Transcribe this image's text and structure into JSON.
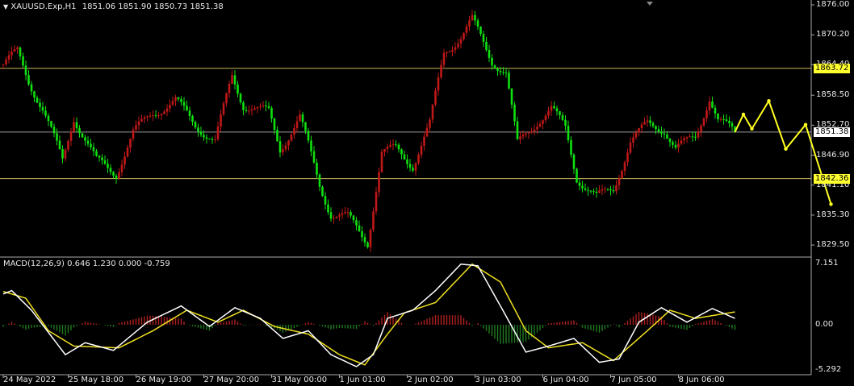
{
  "header": {
    "symbol": "XAUUSD.Exp,H1",
    "ohlc": "1851.06 1851.90 1850.73 1851.38"
  },
  "macd_header": {
    "label": "MACD(12,26,9) 0.646 1.230 0.000 -0.759"
  },
  "colors": {
    "bull": "#c01818",
    "bear": "#10e010",
    "level": "#c8b45a",
    "forecast": "#ffff20",
    "macd": "#ffffff",
    "signal": "#f0e020",
    "hist_pos": "#b02020",
    "hist_neg": "#207a20"
  },
  "chart_data": {
    "type": "candlestick",
    "title": "XAUUSD.Exp,H1",
    "ylim": [
      1827.5,
      1877.0
    ],
    "price_ticks": [
      "1876.00",
      "1870.20",
      "1864.40",
      "1858.50",
      "1852.70",
      "1846.90",
      "1841.10",
      "1835.30",
      "1829.50"
    ],
    "price_tick_values": [
      1876.0,
      1870.2,
      1864.4,
      1858.5,
      1852.7,
      1846.9,
      1841.1,
      1835.3,
      1829.5
    ],
    "levels": [
      {
        "price": 1863.72,
        "label": "1863.72",
        "style": "yellow"
      },
      {
        "price": 1851.38,
        "label": "1851.38",
        "style": "white"
      },
      {
        "price": 1842.36,
        "label": "1842.36",
        "style": "yellow"
      }
    ],
    "bars_total": 260,
    "close_waypoints": [
      [
        0,
        1864.5
      ],
      [
        5,
        1866.8
      ],
      [
        9,
        1861.3
      ],
      [
        14,
        1855.9
      ],
      [
        21,
        1845.7
      ],
      [
        25,
        1854.3
      ],
      [
        33,
        1845.7
      ],
      [
        40,
        1843.4
      ],
      [
        46,
        1851.2
      ],
      [
        53,
        1855.1
      ],
      [
        61,
        1857.4
      ],
      [
        68,
        1852.8
      ],
      [
        75,
        1849.6
      ],
      [
        81,
        1862.1
      ],
      [
        85,
        1856.7
      ],
      [
        94,
        1855.1
      ],
      [
        98,
        1848.1
      ],
      [
        105,
        1854.3
      ],
      [
        112,
        1841.1
      ],
      [
        116,
        1835.6
      ],
      [
        122,
        1834.8
      ],
      [
        129,
        1830.1
      ],
      [
        134,
        1847.3
      ],
      [
        139,
        1848.1
      ],
      [
        145,
        1845.0
      ],
      [
        151,
        1852.8
      ],
      [
        156,
        1866.8
      ],
      [
        162,
        1869.9
      ],
      [
        166,
        1873.0
      ],
      [
        173,
        1865.2
      ],
      [
        178,
        1862.9
      ],
      [
        182,
        1848.9
      ],
      [
        189,
        1853.5
      ],
      [
        194,
        1855.9
      ],
      [
        199,
        1852.0
      ],
      [
        203,
        1842.6
      ],
      [
        210,
        1838.7
      ],
      [
        216,
        1840.3
      ],
      [
        222,
        1849.6
      ],
      [
        228,
        1852.8
      ],
      [
        234,
        1852.0
      ],
      [
        238,
        1848.1
      ],
      [
        245,
        1850.4
      ],
      [
        250,
        1858.2
      ],
      [
        253,
        1853.5
      ],
      [
        259,
        1851.38
      ]
    ],
    "forecast": [
      [
        259,
        1851.38
      ],
      [
        262,
        1854.8
      ],
      [
        265,
        1852.0
      ],
      [
        271,
        1857.4
      ],
      [
        277,
        1848.1
      ],
      [
        284,
        1852.8
      ],
      [
        293,
        1837.4
      ]
    ],
    "x_ticks": [
      "24 May 2022",
      "25 May 18:00",
      "26 May 19:00",
      "27 May 20:00",
      "31 May 00:00",
      "1 Jun 01:00",
      "2 Jun 02:00",
      "3 Jun 03:00",
      "6 Jun 04:00",
      "7 Jun 05:00",
      "8 Jun 06:00"
    ],
    "x_tick_bars": [
      0,
      23,
      47,
      71,
      95,
      119,
      143,
      167,
      191,
      215,
      239
    ],
    "macd": {
      "ylim": [
        -5.292,
        7.151
      ],
      "ticks": [
        "7.151",
        "0.00",
        "-5.292"
      ],
      "tick_values": [
        7.151,
        0,
        -5.292
      ],
      "main_waypoints": [
        [
          0,
          3.6
        ],
        [
          3,
          4.0
        ],
        [
          10,
          1.7
        ],
        [
          22,
          -3.5
        ],
        [
          29,
          -2.1
        ],
        [
          39,
          -3.0
        ],
        [
          51,
          0.3
        ],
        [
          63,
          2.2
        ],
        [
          73,
          -0.2
        ],
        [
          82,
          2.0
        ],
        [
          91,
          0.75
        ],
        [
          99,
          -1.6
        ],
        [
          108,
          -0.7
        ],
        [
          116,
          -3.5
        ],
        [
          125,
          -4.9
        ],
        [
          131,
          -3.5
        ],
        [
          136,
          0.75
        ],
        [
          145,
          1.7
        ],
        [
          153,
          4.0
        ],
        [
          162,
          7.1
        ],
        [
          168,
          6.9
        ],
        [
          176,
          2.2
        ],
        [
          185,
          -3.2
        ],
        [
          193,
          -2.5
        ],
        [
          202,
          -1.6
        ],
        [
          211,
          -4.4
        ],
        [
          218,
          -4.0
        ],
        [
          225,
          0.3
        ],
        [
          233,
          2.0
        ],
        [
          242,
          0.3
        ],
        [
          251,
          1.9
        ],
        [
          259,
          0.75
        ]
      ],
      "signal_waypoints": [
        [
          0,
          3.9
        ],
        [
          8,
          3.1
        ],
        [
          16,
          -0.7
        ],
        [
          25,
          -2.5
        ],
        [
          41,
          -2.7
        ],
        [
          53,
          -0.7
        ],
        [
          65,
          1.7
        ],
        [
          76,
          0.3
        ],
        [
          85,
          1.7
        ],
        [
          96,
          -0.2
        ],
        [
          108,
          -1.1
        ],
        [
          119,
          -3.5
        ],
        [
          128,
          -4.7
        ],
        [
          136,
          -1.1
        ],
        [
          142,
          1.4
        ],
        [
          153,
          2.6
        ],
        [
          166,
          7.1
        ],
        [
          176,
          5.0
        ],
        [
          185,
          -0.7
        ],
        [
          193,
          -2.7
        ],
        [
          205,
          -2.1
        ],
        [
          216,
          -4.2
        ],
        [
          228,
          -0.7
        ],
        [
          236,
          1.7
        ],
        [
          245,
          0.75
        ],
        [
          259,
          1.5
        ]
      ]
    }
  }
}
